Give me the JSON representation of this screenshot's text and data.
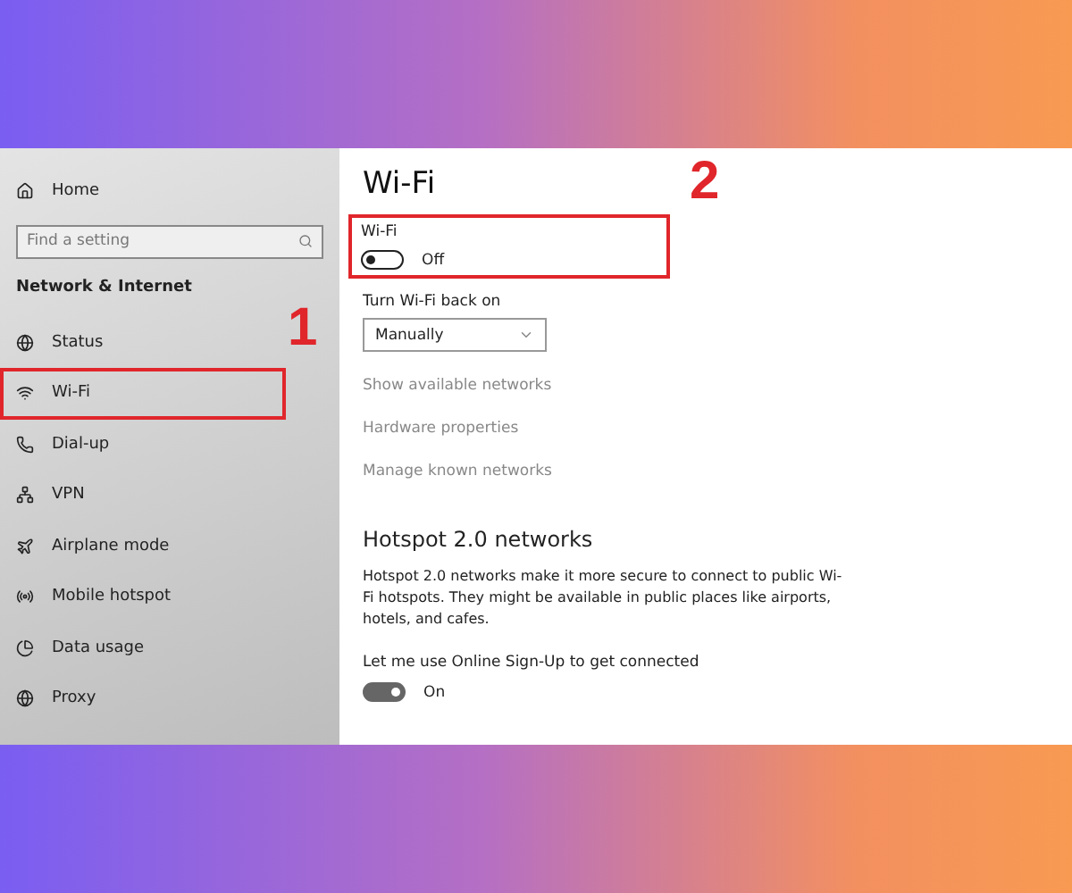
{
  "sidebar": {
    "home": "Home",
    "search": {
      "placeholder": "Find a setting"
    },
    "section_title": "Network & Internet",
    "items": [
      {
        "label": "Status",
        "selected": false
      },
      {
        "label": "Wi-Fi",
        "selected": true
      },
      {
        "label": "Dial-up",
        "selected": false
      },
      {
        "label": "VPN",
        "selected": false
      },
      {
        "label": "Airplane mode",
        "selected": false
      },
      {
        "label": "Mobile hotspot",
        "selected": false
      },
      {
        "label": "Data usage",
        "selected": false
      },
      {
        "label": "Proxy",
        "selected": false
      }
    ]
  },
  "main": {
    "title": "Wi-Fi",
    "wifi_toggle": {
      "label": "Wi-Fi",
      "on": false,
      "state_text": "Off",
      "highlighted": true
    },
    "turn_back_on": {
      "label": "Turn Wi-Fi back on",
      "value": "Manually"
    },
    "links": [
      "Show available networks",
      "Hardware properties",
      "Manage known networks"
    ],
    "hotspot": {
      "heading": "Hotspot 2.0 networks",
      "description": "Hotspot 2.0 networks make it more secure to connect to public Wi-Fi hotspots. They might be available in public places like airports, hotels, and cafes.",
      "signup": {
        "label": "Let me use Online Sign-Up to get connected",
        "on": true,
        "state_text": "On"
      }
    }
  },
  "annotations": [
    {
      "number": "1"
    },
    {
      "number": "2"
    }
  ]
}
